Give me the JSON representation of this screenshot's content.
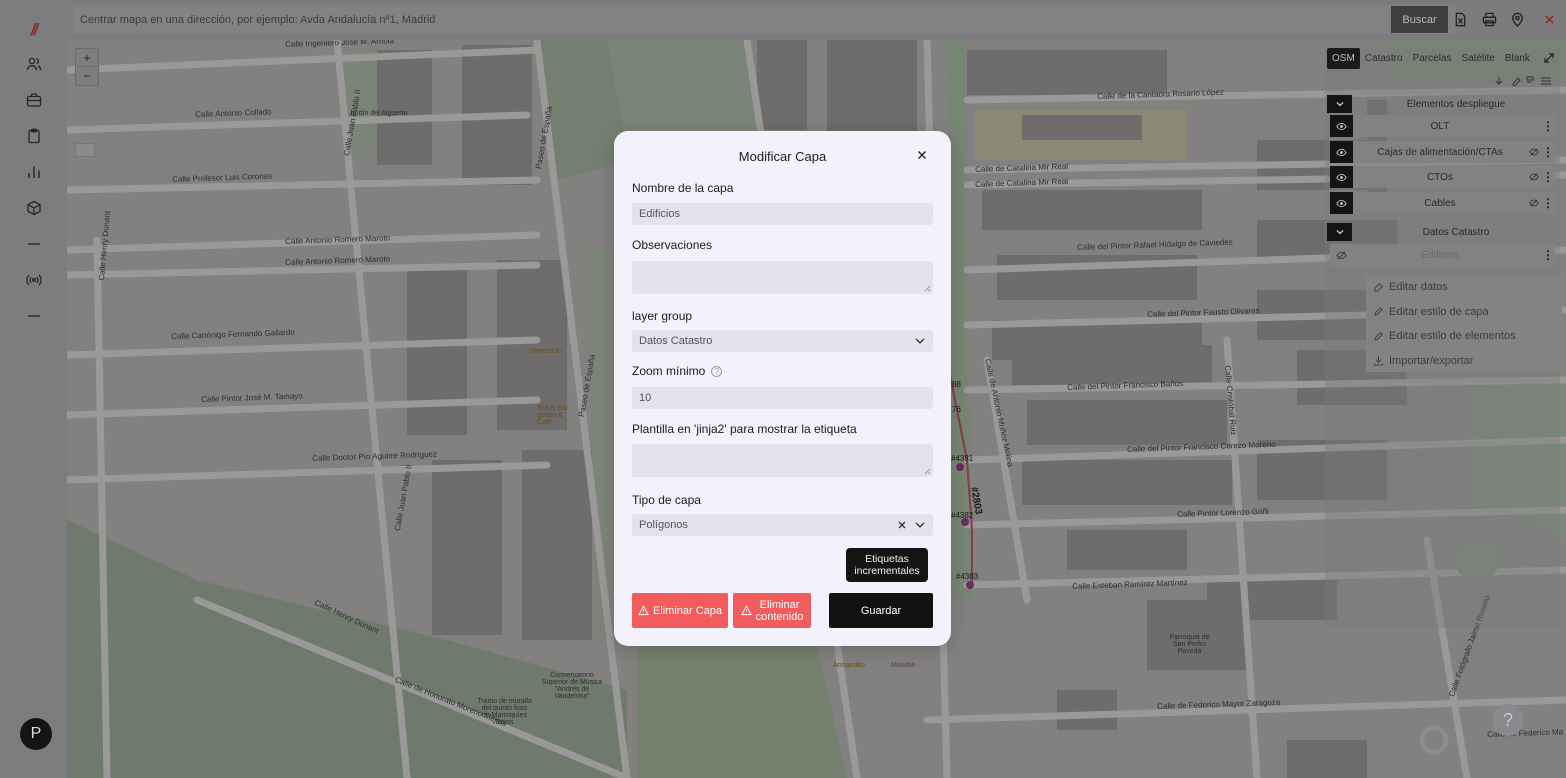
{
  "app": {
    "logo_text": "//",
    "avatar_initial": "P"
  },
  "sidebar": {
    "items": [
      {
        "icon": "users-icon"
      },
      {
        "icon": "briefcase-icon"
      },
      {
        "icon": "clipboard-icon"
      },
      {
        "icon": "bar-chart-icon"
      },
      {
        "icon": "cube-icon"
      },
      {
        "icon": "dash-icon"
      },
      {
        "icon": "broadcast-icon"
      },
      {
        "icon": "dash-icon"
      }
    ]
  },
  "search": {
    "placeholder": "Centrar mapa en una dirección, por ejemplo: Avda Andalucía nº1, Madrid",
    "button_label": "Buscar"
  },
  "map": {
    "zoom_in": "+",
    "zoom_out": "−",
    "help_label": "?",
    "street_labels": [
      "Calle Ingeniero José M. Arriola",
      "Calle Antonio Collado",
      "Calle Profesor Luis Coronas",
      "Calle Antonio Romero Maroto",
      "Calle Antonio Romero Maroto",
      "Calle Canónigo Fernando Gallardo",
      "Calle Pintor José M. Tamayo",
      "Calle Doctor Pío Aguirre Rodríguez",
      "Calle Henry Dunant",
      "Calle Henry Dunant",
      "Calle de Honorato Moreno Mejías",
      "Calle de la Cantaora Rosario López",
      "Calle de Catalina Mir Real",
      "Calle de Catalina Mir Real",
      "Calle del Pintor Rafael Hidalgo de Caviedes",
      "Calle del Pintor Fausto Olivares",
      "Calle del Pintor Francisco Baños",
      "Calle del Pintor Francisco Cerezo Moreno",
      "Calle Pintor Lorenzo Goñi",
      "Calle Esteban Ramírez Martínez",
      "Calle de Federico Mayor Zaragoza",
      "Calle de Federico Ma",
      "Paseo de España",
      "Paseo de España",
      "Calle Juan Pablo II",
      "Calle Juan Pablo II",
      "Calle de Antonio Muñoz Molina",
      "Calle Cristóbal Ruiz",
      "Calle Fotógrafo Jaime Rosello"
    ],
    "poi_labels": [
      "Jardín del Alguerto",
      "Venteciclo",
      "BULE Bar gelato & Café",
      "Conservatorio Superior de Música \"Andrés de Vandelvira\"",
      "Tramo de muralla del quinto foso de Marroquíes Bajos",
      "Parroquia de San Pedro Poveda",
      "Maxidia",
      "Armandito"
    ],
    "feature_labels": [
      "#4381",
      "#2803",
      "#4382",
      "#4383",
      "88",
      "76"
    ]
  },
  "layer_panel": {
    "base_tabs": [
      "OSM",
      "Catastro",
      "Parcelas",
      "Satélite",
      "Blank"
    ],
    "active_base": "OSM",
    "groups": [
      {
        "title": "Elementos despliegue",
        "layers": [
          "OLT",
          "Cajas de alimentación/CTAs",
          "CTOs",
          "Cables"
        ]
      },
      {
        "title": "Datos Catastro",
        "layers": [
          "Edificios"
        ]
      }
    ],
    "context_menu": [
      "Editar datos",
      "Editar estilo de capa",
      "Editar estilo de elementos",
      "Importar/exportar"
    ]
  },
  "modal": {
    "title": "Modificar Capa",
    "fields": {
      "name_label": "Nombre de la capa",
      "name_value": "Edificios",
      "observations_label": "Observaciones",
      "observations_value": "",
      "group_label": "layer group",
      "group_value": "Datos Catastro",
      "zoom_label": "Zoom mínimo",
      "zoom_help": "?",
      "zoom_value": "10",
      "template_label": "Plantilla en 'jinja2' para mostrar la etiqueta",
      "template_value": "",
      "type_label": "Tipo de capa",
      "type_value": "Polígonos"
    },
    "tooltip": "Etiquetas incrementales",
    "buttons": {
      "delete_layer": "Eliminar Capa",
      "delete_content": "Eliminar contenido",
      "save": "Guardar"
    }
  },
  "colors": {
    "danger": "#f25c5c",
    "primary": "#111111",
    "modal_bg": "#f3f1fb",
    "field_bg": "#e4e2ed"
  }
}
